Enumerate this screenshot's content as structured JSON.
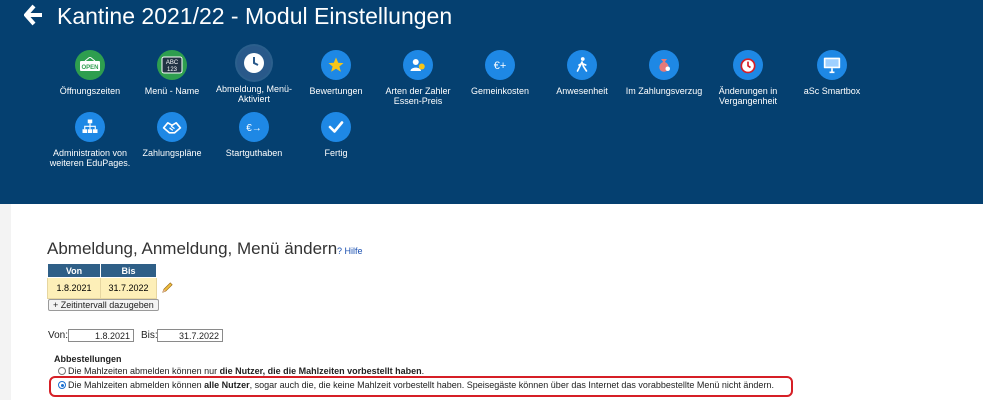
{
  "header": {
    "title": "Kantine 2021/22 - Modul Einstellungen",
    "back_icon": "arrow-left-icon"
  },
  "menu": [
    {
      "label": "Öffnungszeiten",
      "icon": "open-sign-icon",
      "color": "#2e9e4f"
    },
    {
      "label": "Menü - Name",
      "icon": "abc-123-icon",
      "color": "#2e9e4f"
    },
    {
      "label": "Abmeldung, Menü-Aktiviert",
      "icon": "clock-icon",
      "color": "#29598a",
      "active": true
    },
    {
      "label": "Bewertungen",
      "icon": "star-icon",
      "color": "#1e88e5"
    },
    {
      "label": "Arten der Zahler Essen-Preis",
      "icon": "users-icon",
      "color": "#1e88e5"
    },
    {
      "label": "Gemeinkosten",
      "icon": "euro-plus-icon",
      "color": "#1e88e5"
    },
    {
      "label": "Anwesenheit",
      "icon": "walking-person-icon",
      "color": "#1e88e5"
    },
    {
      "label": "Im Zahlungsverzug",
      "icon": "money-bag-icon",
      "color": "#1e88e5"
    },
    {
      "label": "Änderungen in Vergangenheit",
      "icon": "alarm-clock-icon",
      "color": "#1e88e5"
    },
    {
      "label": "aSc Smartbox",
      "icon": "monitor-icon",
      "color": "#1e88e5"
    },
    {
      "label": "Administration von weiteren EduPages.",
      "icon": "org-chart-icon",
      "color": "#1e88e5"
    },
    {
      "label": "Zahlungspläne",
      "icon": "handshake-icon",
      "color": "#1e88e5"
    },
    {
      "label": "Startguthaben",
      "icon": "euro-arrow-icon",
      "color": "#1e88e5"
    },
    {
      "label": "Fertig",
      "icon": "check-icon",
      "color": "#1e88e5"
    }
  ],
  "section": {
    "title": "Abmeldung, Anmeldung, Menü ändern",
    "help_label": "? Hilfe"
  },
  "interval_table": {
    "headers": [
      "Von",
      "Bis"
    ],
    "rows": [
      [
        "1.8.2021",
        "31.7.2022"
      ]
    ]
  },
  "add_interval_label": "+ Zeitintervall dazugeben",
  "range": {
    "from_label": "Von:",
    "from_value": "1.8.2021",
    "to_label": "Bis:",
    "to_value": "31.7.2022"
  },
  "cancellations": {
    "title": "Abbestellungen",
    "options": [
      {
        "pre": "Die Mahlzeiten abmelden können nur ",
        "bold": "die Nutzer, die die Mahlzeiten vorbestellt haben",
        "post": ".",
        "checked": false
      },
      {
        "pre": "Die Mahlzeiten abmelden können ",
        "bold": "alle Nutzer",
        "post": ", sogar auch die, die keine Mahlzeit vorbestellt haben. Speisegäste können über das Internet das vorabbestellte Menü nicht ändern.",
        "checked": true
      }
    ]
  },
  "colors": {
    "header_bg": "#054070",
    "highlight": "#d61f26",
    "table_header": "#2f5f87",
    "table_cell": "#fdefb8"
  }
}
